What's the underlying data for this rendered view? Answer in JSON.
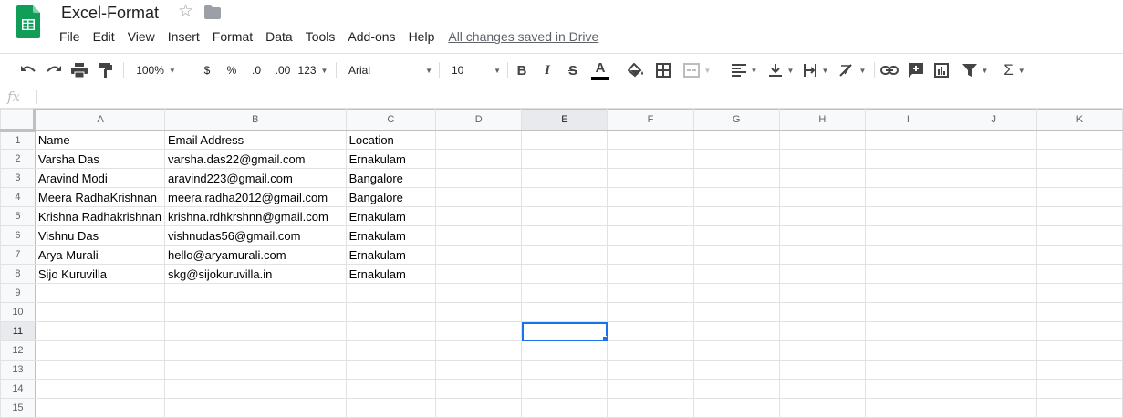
{
  "app": {
    "doc_title": "Excel-Format",
    "brand_color": "#0f9d58",
    "icons": [
      "sheets-logo-icon",
      "star-icon",
      "folder-icon"
    ]
  },
  "menu": {
    "items": [
      "File",
      "Edit",
      "View",
      "Insert",
      "Format",
      "Data",
      "Tools",
      "Add-ons",
      "Help"
    ],
    "save_status": "All changes saved in Drive"
  },
  "toolbar": {
    "zoom": "100%",
    "currency": "$",
    "percent": "%",
    "decrease_decimal": ".0",
    "increase_decimal": ".00",
    "more_formats": "123",
    "font": "Arial",
    "font_size": "10",
    "bold": "B",
    "italic": "I",
    "strikethrough": "S",
    "text_color_label": "A",
    "sum": "Σ",
    "text_color": "#000000"
  },
  "formula_bar": {
    "fx": "fx"
  },
  "grid": {
    "columns": [
      "A",
      "B",
      "C",
      "D",
      "E",
      "F",
      "G",
      "H",
      "I",
      "J",
      "K"
    ],
    "selected_column": "E",
    "selected_row": "11",
    "accent_color": "#1a73e8",
    "rows": [
      {
        "num": "1",
        "cells": [
          "Name",
          "Email Address",
          "Location"
        ]
      },
      {
        "num": "2",
        "cells": [
          "Varsha Das",
          "varsha.das22@gmail.com",
          "Ernakulam"
        ]
      },
      {
        "num": "3",
        "cells": [
          "Aravind Modi",
          "aravind223@gmail.com",
          "Bangalore"
        ]
      },
      {
        "num": "4",
        "cells": [
          "Meera RadhaKrishnan",
          "meera.radha2012@gmail.com",
          "Bangalore"
        ]
      },
      {
        "num": "5",
        "cells": [
          "Krishna Radhakrishnan",
          "krishna.rdhkrshnn@gmail.com",
          "Ernakulam"
        ]
      },
      {
        "num": "6",
        "cells": [
          "Vishnu Das",
          "vishnudas56@gmail.com",
          "Ernakulam"
        ]
      },
      {
        "num": "7",
        "cells": [
          "Arya Murali",
          "hello@aryamurali.com",
          "Ernakulam"
        ]
      },
      {
        "num": "8",
        "cells": [
          "Sijo Kuruvilla",
          "skg@sijokuruvilla.in",
          "Ernakulam"
        ]
      },
      {
        "num": "9",
        "cells": [
          "",
          "",
          ""
        ]
      },
      {
        "num": "10",
        "cells": [
          "",
          "",
          ""
        ]
      },
      {
        "num": "11",
        "cells": [
          "",
          "",
          ""
        ]
      },
      {
        "num": "12",
        "cells": [
          "",
          "",
          ""
        ]
      },
      {
        "num": "13",
        "cells": [
          "",
          "",
          ""
        ]
      },
      {
        "num": "14",
        "cells": [
          "",
          "",
          ""
        ]
      },
      {
        "num": "15",
        "cells": [
          "",
          "",
          ""
        ]
      }
    ]
  }
}
